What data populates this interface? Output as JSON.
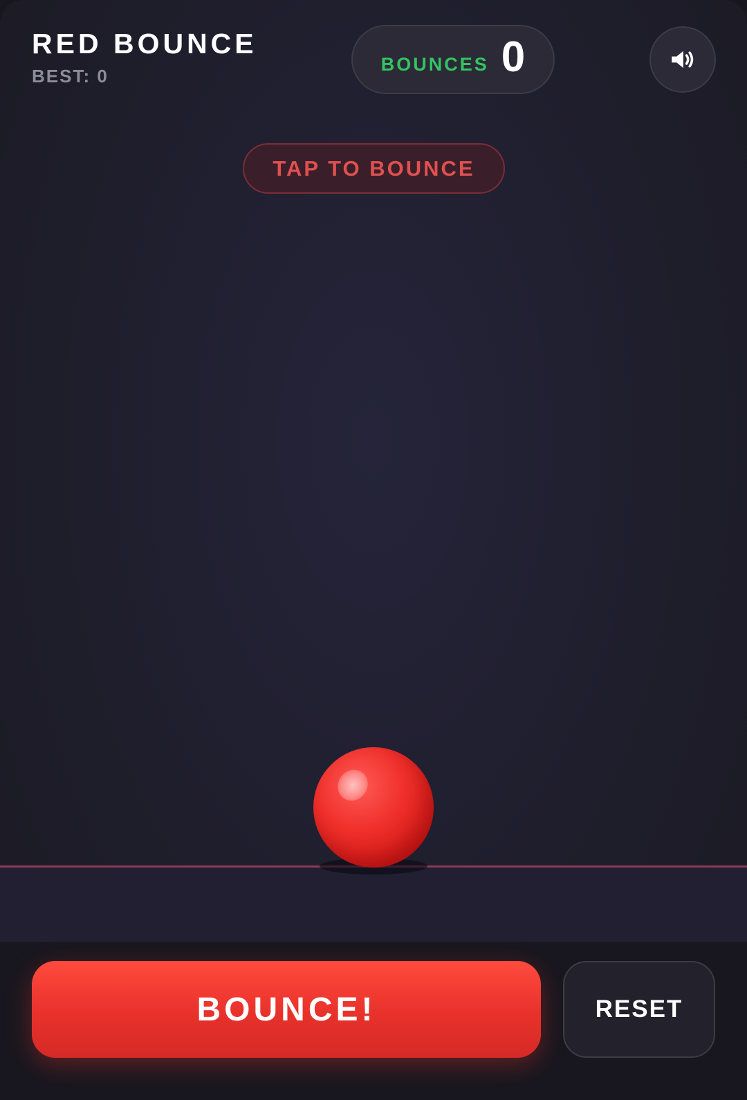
{
  "game": {
    "title": "RED BOUNCE",
    "best_label": "BEST: 0"
  },
  "score": {
    "label": "BOUNCES",
    "value": "0"
  },
  "sound": {
    "icon": "speaker-icon",
    "state": "on"
  },
  "hint": {
    "text": "TAP TO BOUNCE"
  },
  "ball": {
    "color": "#e8302b"
  },
  "controls": {
    "bounce_label": "BOUNCE!",
    "reset_label": "RESET"
  },
  "colors": {
    "accent": "#e8312b",
    "score_label": "#33c463",
    "background": "#1f1e2c",
    "ground_line": "#8c3a55"
  }
}
